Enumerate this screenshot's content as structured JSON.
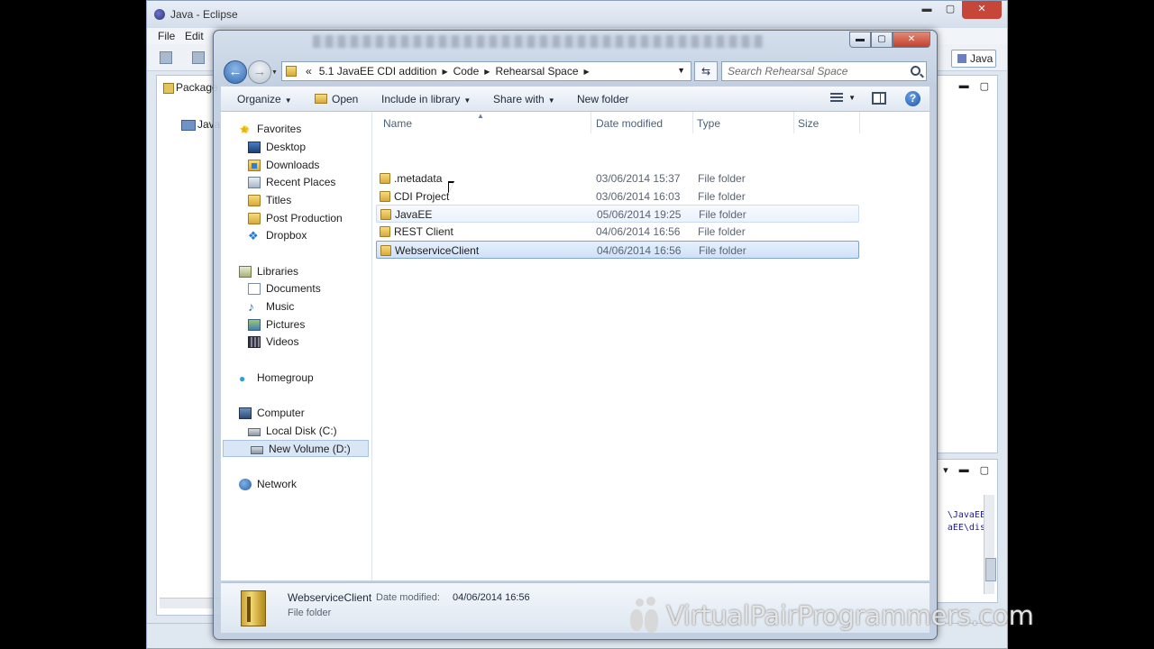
{
  "eclipse": {
    "title": "Java - Eclipse",
    "menu": [
      "File",
      "Edit"
    ],
    "perspective_label": "Java",
    "package_tab": "Package",
    "package_item": "Java",
    "console_lines": [
      "\\JavaEE\\",
      "aEE\\dist"
    ]
  },
  "explorer": {
    "address": {
      "overflow": "«",
      "crumbs": [
        "5.1 JavaEE CDI addition",
        "Code",
        "Rehearsal Space"
      ]
    },
    "search_placeholder": "Search Rehearsal Space",
    "toolbar": {
      "organize": "Organize",
      "open": "Open",
      "include_in_library": "Include in library",
      "share_with": "Share with",
      "new_folder": "New folder"
    },
    "navigation": {
      "favorites": {
        "label": "Favorites",
        "items": [
          "Desktop",
          "Downloads",
          "Recent Places",
          "Titles",
          "Post Production",
          "Dropbox"
        ]
      },
      "libraries": {
        "label": "Libraries",
        "items": [
          "Documents",
          "Music",
          "Pictures",
          "Videos"
        ]
      },
      "homegroup": "Homegroup",
      "computer": {
        "label": "Computer",
        "items": [
          "Local Disk (C:)",
          "New Volume (D:)"
        ]
      },
      "network": "Network"
    },
    "columns": {
      "name": "Name",
      "date_modified": "Date modified",
      "type": "Type",
      "size": "Size"
    },
    "files": [
      {
        "name": ".metadata",
        "date": "03/06/2014 15:37",
        "type": "File folder"
      },
      {
        "name": "CDI Project",
        "date": "03/06/2014 16:03",
        "type": "File folder"
      },
      {
        "name": "JavaEE",
        "date": "05/06/2014 19:25",
        "type": "File folder"
      },
      {
        "name": "REST Client",
        "date": "04/06/2014 16:56",
        "type": "File folder"
      },
      {
        "name": "WebserviceClient",
        "date": "04/06/2014 16:56",
        "type": "File folder"
      }
    ],
    "details": {
      "name": "WebserviceClient",
      "modified_label": "Date modified:",
      "modified_value": "04/06/2014 16:56",
      "type": "File folder"
    }
  },
  "watermark": "VirtualPairProgrammers.com",
  "colors": {
    "selection": "#cfe1f8",
    "selection_border": "#7da2ce",
    "window_frame": "#c3d1e2"
  }
}
